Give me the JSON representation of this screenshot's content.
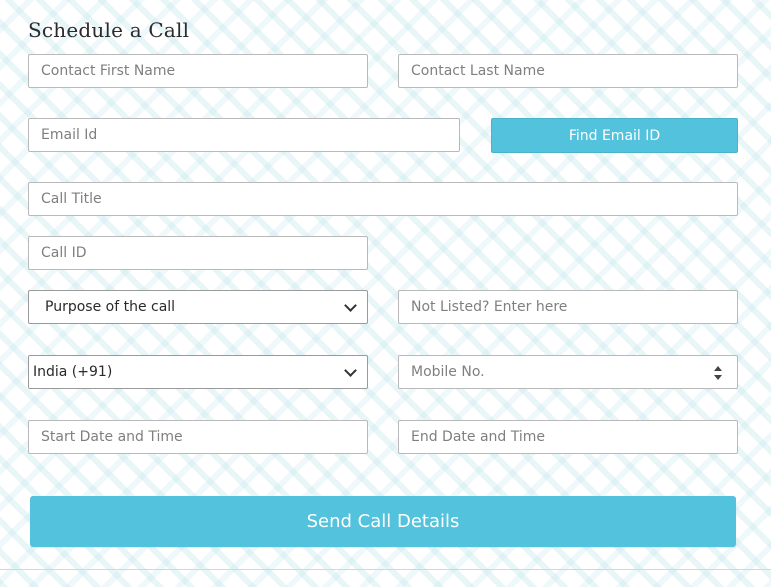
{
  "form": {
    "title": "Schedule a Call",
    "contact_first_name": {
      "placeholder": "Contact First Name"
    },
    "contact_last_name": {
      "placeholder": "Contact Last Name"
    },
    "email": {
      "placeholder": "Email Id"
    },
    "find_email_button": "Find Email ID",
    "call_title": {
      "placeholder": "Call Title"
    },
    "call_id": {
      "placeholder": "Call ID"
    },
    "purpose_select": {
      "selected": "Purpose of the call"
    },
    "not_listed": {
      "placeholder": "Not Listed? Enter here"
    },
    "country_select": {
      "selected": "India (+91)"
    },
    "mobile": {
      "placeholder": "Mobile No."
    },
    "start_datetime": {
      "placeholder": "Start Date and Time"
    },
    "end_datetime": {
      "placeholder": "End Date and Time"
    },
    "send_button": "Send Call Details"
  },
  "colors": {
    "accent": "#53c2dc",
    "background_pattern": "#bee4ec",
    "input_border": "#b9b9b9",
    "placeholder_text": "#7f7f7f"
  },
  "icons": {
    "purpose_dropdown": "chevron-down-icon",
    "country_dropdown": "chevron-down-icon",
    "mobile_spinner": "number-spinner-icon"
  }
}
